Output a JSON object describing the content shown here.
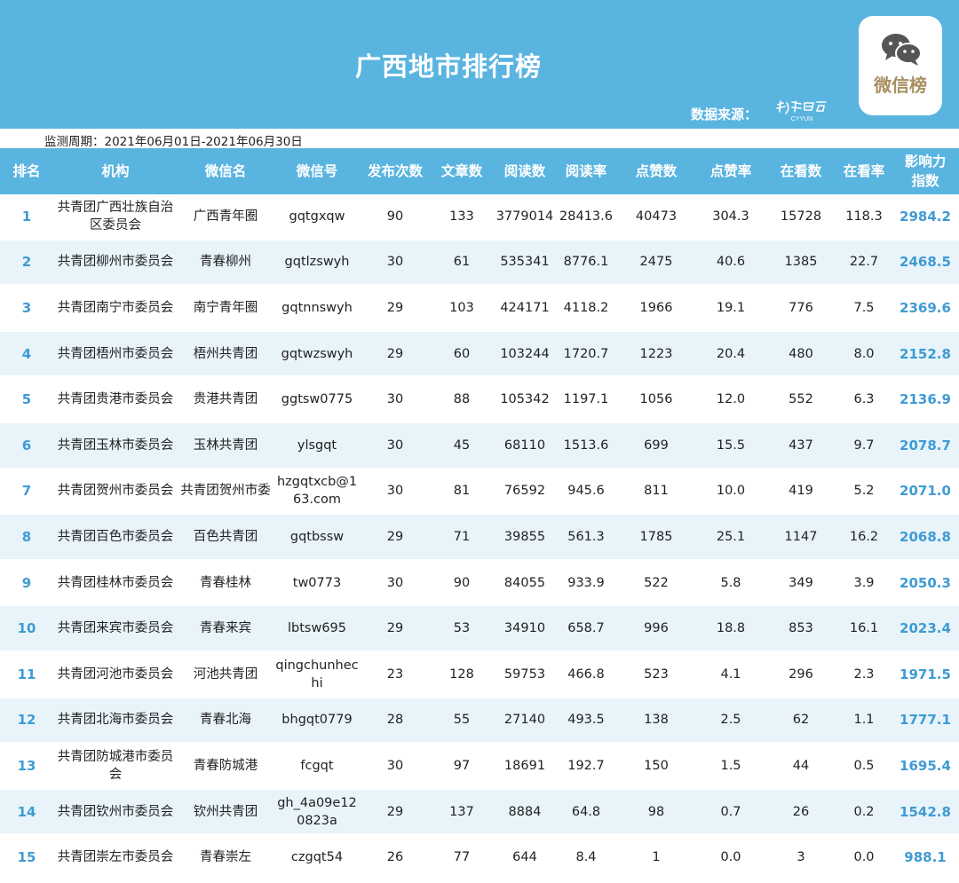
{
  "banner": {
    "title": "广西地市排行榜",
    "source_label": "数据来源：",
    "source_logo_text": "CYYUN",
    "badge_text": "微信榜",
    "accent": "#5ab4e0"
  },
  "period": "监测周期：2021年06月01日-2021年06月30日",
  "columns": {
    "rank": "排名",
    "org": "机构",
    "name": "微信名",
    "id": "微信号",
    "pub": "发布次数",
    "art": "文章数",
    "read": "阅读数",
    "rrate": "阅读率",
    "like": "点赞数",
    "lrate": "点赞率",
    "look": "在看数",
    "lkrate": "在看率",
    "score": "影响力指数"
  },
  "rows": [
    {
      "rank": "1",
      "org": "共青团广西壮族自治区委员会",
      "name": "广西青年圈",
      "id": "gqtgxqw",
      "pub": "90",
      "art": "133",
      "read": "3779014",
      "rrate": "28413.6",
      "like": "40473",
      "lrate": "304.3",
      "look": "15728",
      "lkrate": "118.3",
      "score": "2984.2"
    },
    {
      "rank": "2",
      "org": "共青团柳州市委员会",
      "name": "青春柳州",
      "id": "gqtlzswyh",
      "pub": "30",
      "art": "61",
      "read": "535341",
      "rrate": "8776.1",
      "like": "2475",
      "lrate": "40.6",
      "look": "1385",
      "lkrate": "22.7",
      "score": "2468.5"
    },
    {
      "rank": "3",
      "org": "共青团南宁市委员会",
      "name": "南宁青年圈",
      "id": "gqtnnswyh",
      "pub": "29",
      "art": "103",
      "read": "424171",
      "rrate": "4118.2",
      "like": "1966",
      "lrate": "19.1",
      "look": "776",
      "lkrate": "7.5",
      "score": "2369.6"
    },
    {
      "rank": "4",
      "org": "共青团梧州市委员会",
      "name": "梧州共青团",
      "id": "gqtwzswyh",
      "pub": "29",
      "art": "60",
      "read": "103244",
      "rrate": "1720.7",
      "like": "1223",
      "lrate": "20.4",
      "look": "480",
      "lkrate": "8.0",
      "score": "2152.8"
    },
    {
      "rank": "5",
      "org": "共青团贵港市委员会",
      "name": "贵港共青团",
      "id": "ggtsw0775",
      "pub": "30",
      "art": "88",
      "read": "105342",
      "rrate": "1197.1",
      "like": "1056",
      "lrate": "12.0",
      "look": "552",
      "lkrate": "6.3",
      "score": "2136.9"
    },
    {
      "rank": "6",
      "org": "共青团玉林市委员会",
      "name": "玉林共青团",
      "id": "ylsgqt",
      "pub": "30",
      "art": "45",
      "read": "68110",
      "rrate": "1513.6",
      "like": "699",
      "lrate": "15.5",
      "look": "437",
      "lkrate": "9.7",
      "score": "2078.7"
    },
    {
      "rank": "7",
      "org": "共青团贺州市委员会",
      "name": "共青团贺州市委",
      "id": "hzgqtxcb@163.com",
      "pub": "30",
      "art": "81",
      "read": "76592",
      "rrate": "945.6",
      "like": "811",
      "lrate": "10.0",
      "look": "419",
      "lkrate": "5.2",
      "score": "2071.0"
    },
    {
      "rank": "8",
      "org": "共青团百色市委员会",
      "name": "百色共青团",
      "id": "gqtbssw",
      "pub": "29",
      "art": "71",
      "read": "39855",
      "rrate": "561.3",
      "like": "1785",
      "lrate": "25.1",
      "look": "1147",
      "lkrate": "16.2",
      "score": "2068.8"
    },
    {
      "rank": "9",
      "org": "共青团桂林市委员会",
      "name": "青春桂林",
      "id": "tw0773",
      "pub": "30",
      "art": "90",
      "read": "84055",
      "rrate": "933.9",
      "like": "522",
      "lrate": "5.8",
      "look": "349",
      "lkrate": "3.9",
      "score": "2050.3"
    },
    {
      "rank": "10",
      "org": "共青团来宾市委员会",
      "name": "青春来宾",
      "id": "lbtsw695",
      "pub": "29",
      "art": "53",
      "read": "34910",
      "rrate": "658.7",
      "like": "996",
      "lrate": "18.8",
      "look": "853",
      "lkrate": "16.1",
      "score": "2023.4"
    },
    {
      "rank": "11",
      "org": "共青团河池市委员会",
      "name": "河池共青团",
      "id": "qingchunhechi",
      "pub": "23",
      "art": "128",
      "read": "59753",
      "rrate": "466.8",
      "like": "523",
      "lrate": "4.1",
      "look": "296",
      "lkrate": "2.3",
      "score": "1971.5"
    },
    {
      "rank": "12",
      "org": "共青团北海市委员会",
      "name": "青春北海",
      "id": "bhgqt0779",
      "pub": "28",
      "art": "55",
      "read": "27140",
      "rrate": "493.5",
      "like": "138",
      "lrate": "2.5",
      "look": "62",
      "lkrate": "1.1",
      "score": "1777.1"
    },
    {
      "rank": "13",
      "org": "共青团防城港市委员会",
      "name": "青春防城港",
      "id": "fcgqt",
      "pub": "30",
      "art": "97",
      "read": "18691",
      "rrate": "192.7",
      "like": "150",
      "lrate": "1.5",
      "look": "44",
      "lkrate": "0.5",
      "score": "1695.4"
    },
    {
      "rank": "14",
      "org": "共青团钦州市委员会",
      "name": "钦州共青团",
      "id": "gh_4a09e120823a",
      "pub": "29",
      "art": "137",
      "read": "8884",
      "rrate": "64.8",
      "like": "98",
      "lrate": "0.7",
      "look": "26",
      "lkrate": "0.2",
      "score": "1542.8"
    },
    {
      "rank": "15",
      "org": "共青团崇左市委员会",
      "name": "青春崇左",
      "id": "czgqt54",
      "pub": "26",
      "art": "77",
      "read": "644",
      "rrate": "8.4",
      "like": "1",
      "lrate": "0.0",
      "look": "3",
      "lkrate": "0.0",
      "score": "988.1"
    }
  ]
}
